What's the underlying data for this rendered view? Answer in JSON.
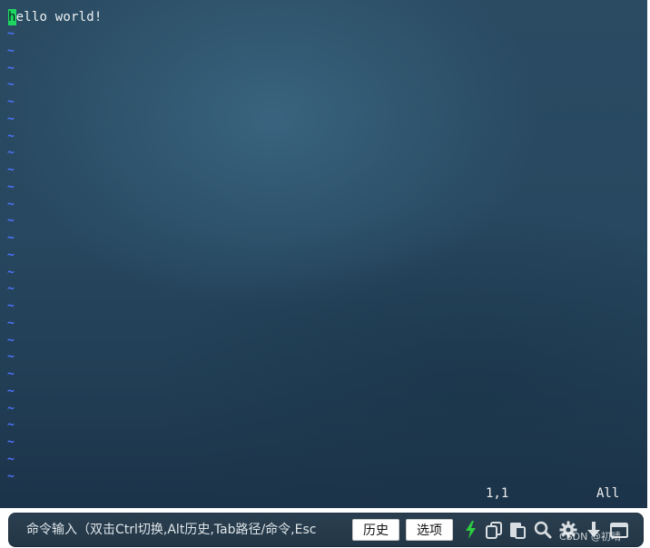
{
  "editor": {
    "cursor_char": "h",
    "line_rest": "ello world!",
    "tilde": "~",
    "tilde_count": 27,
    "ruler_position": "1,1",
    "ruler_scope": "All"
  },
  "command_bar": {
    "input_placeholder": "命令输入（双击Ctrl切换,Alt历史,Tab路径/命令,Esc",
    "history_label": "历史",
    "options_label": "选项",
    "icons": [
      "lightning-icon",
      "copy-icon",
      "paste-icon",
      "search-icon",
      "gear-icon",
      "download-icon",
      "window-icon"
    ]
  },
  "watermark": {
    "text": "CSDN @初晴~"
  },
  "colors": {
    "cursor": "#1ed760",
    "tilde": "#4f74ff",
    "lightning": "#2ecc40"
  }
}
